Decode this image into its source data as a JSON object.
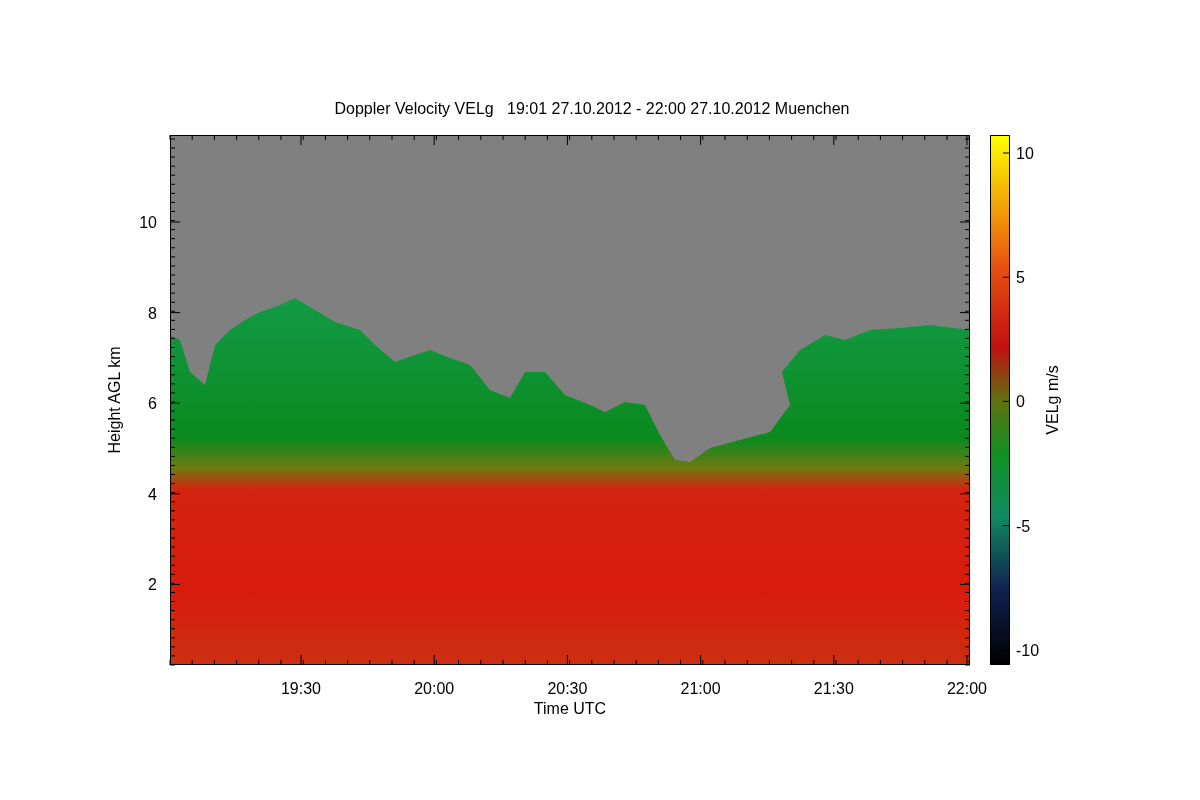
{
  "title": "Doppler Velocity VELg   19:01 27.10.2012 - 22:00 27.10.2012 Muenchen",
  "plot": {
    "xlabel": "Time UTC",
    "ylabel": "Height AGL km",
    "xticks": [
      "19:30",
      "20:00",
      "20:30",
      "21:00",
      "21:30",
      "22:00"
    ],
    "yticks": [
      "10",
      "8",
      "6",
      "4",
      "2"
    ]
  },
  "colorbar": {
    "label": "VELg m/s",
    "ticks": [
      "10",
      "5",
      "0",
      "-5",
      "-10"
    ]
  }
}
